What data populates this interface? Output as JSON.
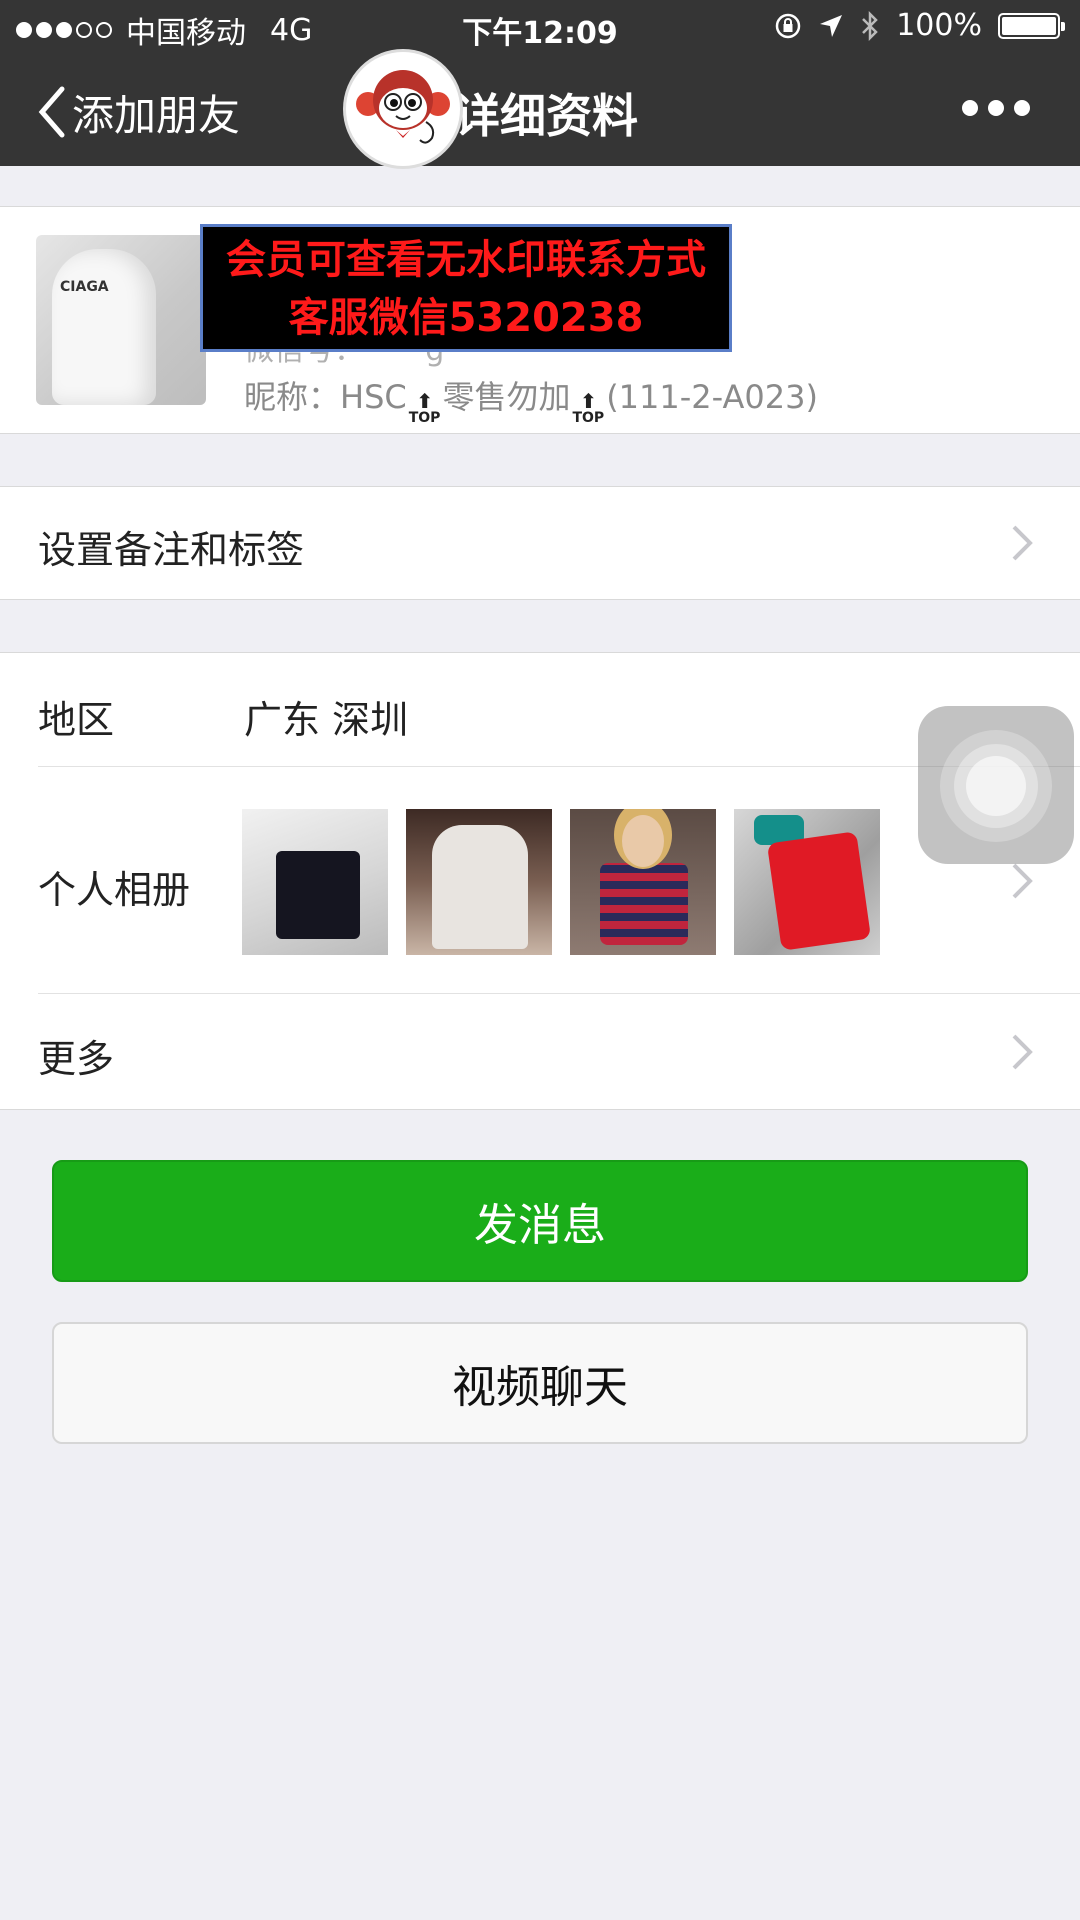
{
  "status": {
    "carrier": "中国移动",
    "network": "4G",
    "time": "下午12:09",
    "battery": "100%"
  },
  "nav": {
    "back_label": "添加朋友",
    "title": "详细资料"
  },
  "profile": {
    "overlay_line1": "会员可查看无水印联系方式",
    "overlay_line2": "客服微信5320238",
    "avatar_text": "CIAGA",
    "nickname_prefix": "昵称：",
    "nickname_part1": "HSC",
    "nickname_part2": "零售勿加",
    "nickname_part3": "(111-2-A023)",
    "top_badge": "TOP"
  },
  "cells": {
    "remark_label": "设置备注和标签",
    "region_label": "地区",
    "region_value": "广东 深圳",
    "album_label": "个人相册",
    "more_label": "更多"
  },
  "buttons": {
    "send_message": "发消息",
    "video_chat": "视频聊天"
  },
  "colors": {
    "topbar": "#353535",
    "primary_green": "#1aad19",
    "background": "#efeff4",
    "overlay_text": "#ff1a1a"
  }
}
